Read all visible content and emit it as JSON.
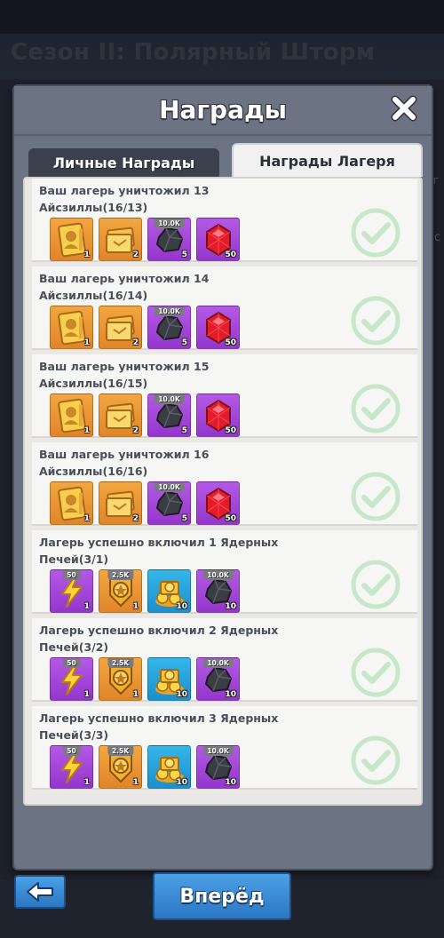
{
  "background": {
    "season_title": "Сезон II: Полярный Шторм",
    "side_text_1": "г",
    "side_text_2": "с"
  },
  "modal": {
    "title": "Награды",
    "close_icon": "close-x-icon",
    "tabs": [
      {
        "label": "Личные Награды",
        "active": false
      },
      {
        "label": "Награды Лагеря",
        "active": true
      }
    ]
  },
  "rewards": [
    {
      "text": "Ваш лагерь уничтожил 13 Айсзиллы(16/13)",
      "completed": true,
      "items": [
        {
          "icon": "golden-card-icon",
          "color": "orange",
          "qty": "1",
          "badge": ""
        },
        {
          "icon": "gold-tickets-icon",
          "color": "orange",
          "qty": "2",
          "badge": ""
        },
        {
          "icon": "coal-rock-icon",
          "color": "purple",
          "qty": "5",
          "badge": "10.0K"
        },
        {
          "icon": "red-gem-icon",
          "color": "purple",
          "qty": "50",
          "badge": ""
        }
      ]
    },
    {
      "text": "Ваш лагерь уничтожил 14 Айсзиллы(16/14)",
      "completed": true,
      "items": [
        {
          "icon": "golden-card-icon",
          "color": "orange",
          "qty": "1",
          "badge": ""
        },
        {
          "icon": "gold-tickets-icon",
          "color": "orange",
          "qty": "2",
          "badge": ""
        },
        {
          "icon": "coal-rock-icon",
          "color": "purple",
          "qty": "5",
          "badge": "10.0K"
        },
        {
          "icon": "red-gem-icon",
          "color": "purple",
          "qty": "50",
          "badge": ""
        }
      ]
    },
    {
      "text": "Ваш лагерь уничтожил 15 Айсзиллы(16/15)",
      "completed": true,
      "items": [
        {
          "icon": "golden-card-icon",
          "color": "orange",
          "qty": "1",
          "badge": ""
        },
        {
          "icon": "gold-tickets-icon",
          "color": "orange",
          "qty": "2",
          "badge": ""
        },
        {
          "icon": "coal-rock-icon",
          "color": "purple",
          "qty": "5",
          "badge": "10.0K"
        },
        {
          "icon": "red-gem-icon",
          "color": "purple",
          "qty": "50",
          "badge": ""
        }
      ]
    },
    {
      "text": "Ваш лагерь уничтожил 16 Айсзиллы(16/16)",
      "completed": true,
      "items": [
        {
          "icon": "golden-card-icon",
          "color": "orange",
          "qty": "1",
          "badge": ""
        },
        {
          "icon": "gold-tickets-icon",
          "color": "orange",
          "qty": "2",
          "badge": ""
        },
        {
          "icon": "coal-rock-icon",
          "color": "purple",
          "qty": "5",
          "badge": "10.0K"
        },
        {
          "icon": "red-gem-icon",
          "color": "purple",
          "qty": "50",
          "badge": ""
        }
      ]
    },
    {
      "text": "Лагерь успешно включил 1 Ядерных Печей(3/1)",
      "completed": true,
      "items": [
        {
          "icon": "lightning-icon",
          "color": "purple",
          "qty": "1",
          "badge": "50"
        },
        {
          "icon": "medal-badge-icon",
          "color": "orange",
          "qty": "1",
          "badge": "2.5K"
        },
        {
          "icon": "gold-chest-icon",
          "color": "blue",
          "qty": "10",
          "badge": ""
        },
        {
          "icon": "coal-rock-icon",
          "color": "purple",
          "qty": "10",
          "badge": "10.0K"
        }
      ]
    },
    {
      "text": "Лагерь успешно включил 2 Ядерных Печей(3/2)",
      "completed": true,
      "items": [
        {
          "icon": "lightning-icon",
          "color": "purple",
          "qty": "1",
          "badge": "50"
        },
        {
          "icon": "medal-badge-icon",
          "color": "orange",
          "qty": "1",
          "badge": "2.5K"
        },
        {
          "icon": "gold-chest-icon",
          "color": "blue",
          "qty": "10",
          "badge": ""
        },
        {
          "icon": "coal-rock-icon",
          "color": "purple",
          "qty": "10",
          "badge": "10.0K"
        }
      ]
    },
    {
      "text": "Лагерь успешно включил 3 Ядерных Печей(3/3)",
      "completed": true,
      "items": [
        {
          "icon": "lightning-icon",
          "color": "purple",
          "qty": "1",
          "badge": "50"
        },
        {
          "icon": "medal-badge-icon",
          "color": "orange",
          "qty": "1",
          "badge": "2.5K"
        },
        {
          "icon": "gold-chest-icon",
          "color": "blue",
          "qty": "10",
          "badge": ""
        },
        {
          "icon": "coal-rock-icon",
          "color": "purple",
          "qty": "10",
          "badge": "10.0K"
        }
      ]
    }
  ],
  "footer": {
    "back_icon": "arrow-left-icon",
    "forward_label": "Вперёд"
  },
  "colors": {
    "check": "#c6e8c9",
    "row_bg": "#f6f6f4",
    "button_blue": "#2c77c4"
  }
}
